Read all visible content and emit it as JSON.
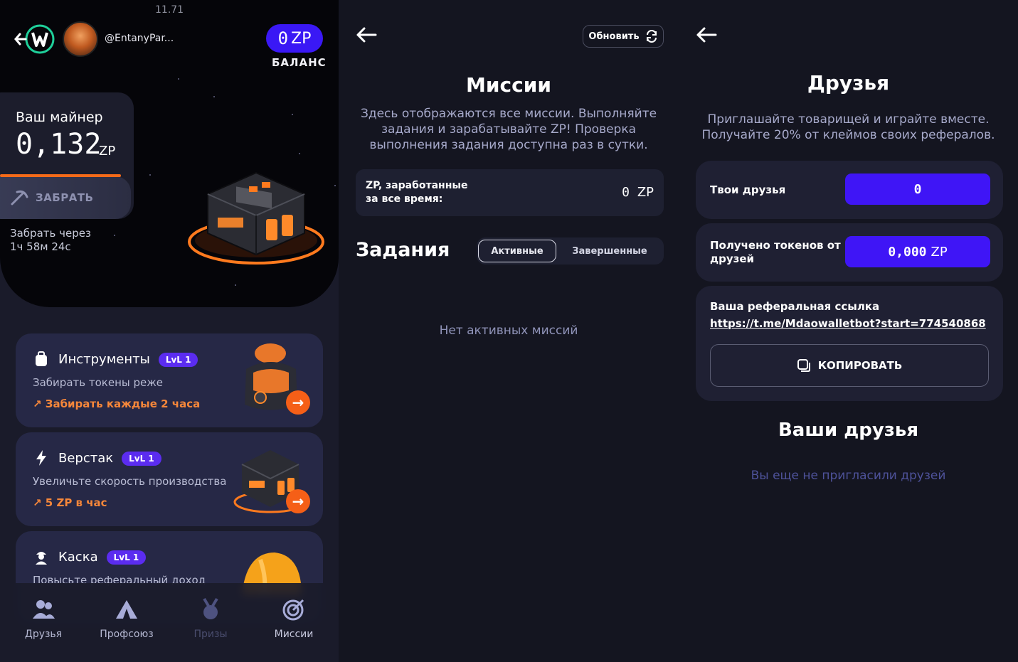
{
  "colors": {
    "accent": "#3f15f6",
    "orange": "#f55f17",
    "bg": "#141520"
  },
  "mining": {
    "time": "11.71",
    "username": "@EntanyPar...",
    "balance_value": "0",
    "balance_unit": "ZP",
    "balance_label": "БАЛАНС",
    "miner_title": "Ваш майнер",
    "miner_value": "0,132",
    "miner_unit": "ZP",
    "claim_label": "ЗАБРАТЬ",
    "claim_in_line1": "Забрать через",
    "claim_in_line2": "1ч 58м 24с",
    "upgrades": [
      {
        "title": "Инструменты",
        "level": "LvL 1",
        "desc": "Забирать токены реже",
        "bonus": "↗ Забирать каждые 2 часа",
        "icon": "backpack-icon"
      },
      {
        "title": "Верстак",
        "level": "LvL 1",
        "desc": "Увеличьте скорость производства",
        "bonus": "↗ 5 ZP в час",
        "icon": "lightning-icon"
      },
      {
        "title": "Каска",
        "level": "LvL 1",
        "desc": "Повысьте реферальный доход",
        "bonus": "",
        "icon": "worker-icon"
      }
    ],
    "nav": [
      {
        "label": "Друзья",
        "icon": "friends-icon"
      },
      {
        "label": "Профсоюз",
        "icon": "tent-icon"
      },
      {
        "label": "Призы",
        "icon": "medal-icon"
      },
      {
        "label": "Миссии",
        "icon": "target-icon"
      }
    ]
  },
  "missions": {
    "refresh_label": "Обновить",
    "title": "Миссии",
    "subtitle_l1": "Здесь отображаются все миссии. Выполняйте",
    "subtitle_l2": "задания и зарабатывайте ZP! Проверка",
    "subtitle_l3": "выполнения задания доступна раз в сутки.",
    "earned_label_l1": "ZP, заработанные",
    "earned_label_l2": "за все время:",
    "earned_value": "0",
    "earned_unit": "ZP",
    "tasks_title": "Задания",
    "tab_active": "Активные",
    "tab_done": "Завершенные",
    "empty": "Нет активных миссий"
  },
  "friends": {
    "title": "Друзья",
    "subtitle_l1": "Приглашайте товарищей и играйте вместе.",
    "subtitle_l2": "Получайте 20% от клеймов своих рефералов.",
    "your_friends_label": "Твои друзья",
    "your_friends_value": "0",
    "tokens_label_l1": "Получено токенов от",
    "tokens_label_l2": "друзей",
    "tokens_value": "0,000",
    "tokens_unit": "ZP",
    "ref_label": "Ваша реферальная ссылка",
    "ref_link": "https://t.me/Mdaowalletbot?start=774540868",
    "copy_label": "КОПИРОВАТЬ",
    "your_friends_title": "Ваши друзья",
    "empty": "Вы еще не пригласили друзей"
  }
}
